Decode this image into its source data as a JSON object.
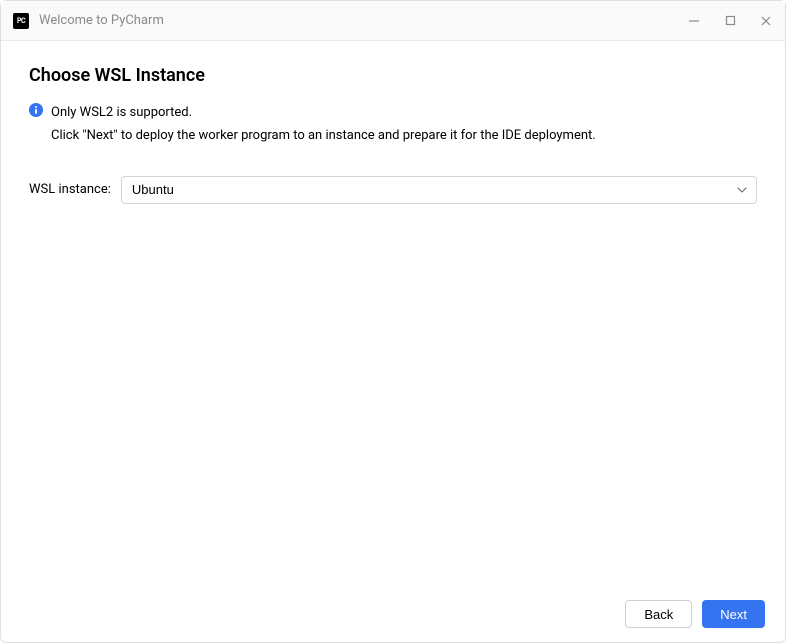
{
  "titlebar": {
    "app_icon_text": "PC",
    "title": "Welcome to PyCharm"
  },
  "main": {
    "heading": "Choose WSL Instance",
    "info_line1": "Only WSL2 is supported.",
    "info_line2": "Click \"Next\" to deploy the worker program to an instance and prepare it for the IDE deployment."
  },
  "form": {
    "wsl_instance_label": "WSL instance:",
    "wsl_instance_value": "Ubuntu"
  },
  "footer": {
    "back_label": "Back",
    "next_label": "Next"
  }
}
